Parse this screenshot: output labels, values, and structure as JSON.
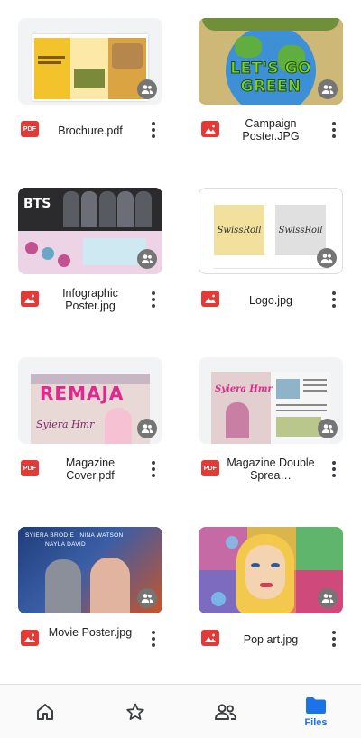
{
  "files": [
    {
      "name": "Brochure.pdf",
      "type": "pdf",
      "type_label": "PDF",
      "lines": 1
    },
    {
      "name": "Campaign Poster.JPG",
      "type": "image",
      "lines": 2,
      "thumb_text": "LET'S GO GREEN"
    },
    {
      "name": "Infographic Poster.jpg",
      "type": "image",
      "lines": 2,
      "thumb_text": "BTS"
    },
    {
      "name": "Logo.jpg",
      "type": "image",
      "lines": 1,
      "thumb_text_a": "SwissRoll",
      "thumb_text_b": "SwissRoll"
    },
    {
      "name": "Magazine Cover.pdf",
      "type": "pdf",
      "type_label": "PDF",
      "lines": 2,
      "thumb_text": "REMAJA",
      "thumb_sub": "Syiera Hmr"
    },
    {
      "name": "Magazine Double Sprea…",
      "type": "pdf",
      "type_label": "PDF",
      "lines": 2,
      "thumb_text": "Syiera Hmr"
    },
    {
      "name": "Movie Poster.jpg",
      "type": "image",
      "lines": 2,
      "thumb_names": "SYIERA BRODIE   NINA WATSON",
      "thumb_names2": "NAYLA DAVID"
    },
    {
      "name": "Pop art.jpg",
      "type": "image",
      "lines": 1
    }
  ],
  "nav": {
    "home_icon": "home-icon",
    "starred_icon": "star-icon",
    "shared_icon": "people-icon",
    "files_icon": "folder-icon",
    "files_label": "Files"
  },
  "colors": {
    "accent": "#1a73e8",
    "pdf": "#e53935",
    "image": "#e53935"
  }
}
